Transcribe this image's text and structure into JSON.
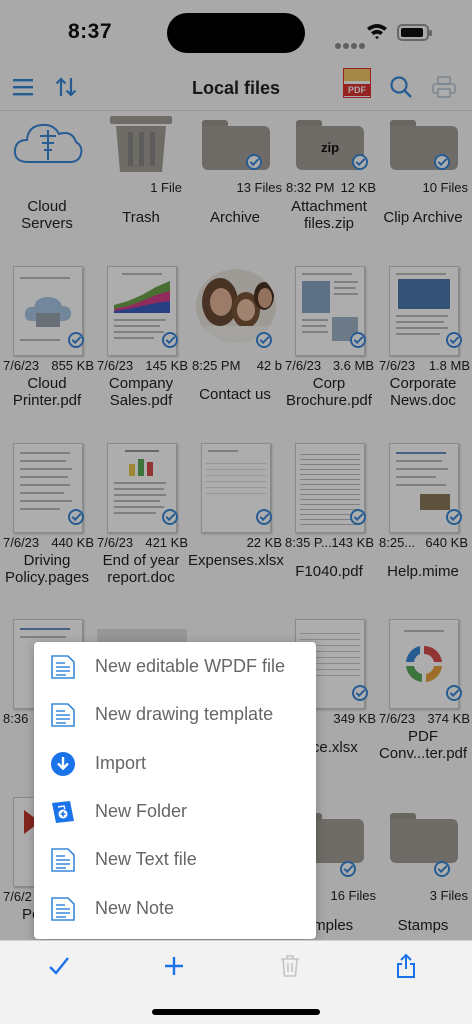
{
  "status": {
    "time": "8:37"
  },
  "nav": {
    "title": "Local files",
    "pdf_logo_text": "PDF"
  },
  "row1": [
    {
      "name": "Cloud Servers",
      "meta_left": "",
      "meta_right": ""
    },
    {
      "name": "Trash",
      "meta_left": "",
      "meta_right": "1 File"
    },
    {
      "name": "Archive",
      "meta_left": "",
      "meta_right": "13 Files"
    },
    {
      "name": "Attachment files.zip",
      "meta_left": "8:32 PM",
      "meta_right": "12 KB",
      "badge": "zip"
    },
    {
      "name": "Clip Archive",
      "meta_left": "",
      "meta_right": "10 Files"
    }
  ],
  "row2": [
    {
      "name": "Cloud Printer.pdf",
      "meta_left": "7/6/23",
      "meta_right": "855 KB"
    },
    {
      "name": "Company Sales.pdf",
      "meta_left": "7/6/23",
      "meta_right": "145 KB"
    },
    {
      "name": "Contact us",
      "meta_left": "8:25 PM",
      "meta_right": "42 b"
    },
    {
      "name": "Corp Brochure.pdf",
      "meta_left": "7/6/23",
      "meta_right": "3.6 MB"
    },
    {
      "name": "Corporate News.doc",
      "meta_left": "7/6/23",
      "meta_right": "1.8 MB"
    }
  ],
  "row3": [
    {
      "name": "Driving Policy.pages",
      "meta_left": "7/6/23",
      "meta_right": "440 KB"
    },
    {
      "name": "End of year report.doc",
      "meta_left": "7/6/23",
      "meta_right": "421 KB"
    },
    {
      "name": "Expenses.xlsx",
      "meta_left": "",
      "meta_right": "22 KB"
    },
    {
      "name": "F1040.pdf",
      "meta_left": "8:35 P...",
      "meta_right": "143 KB"
    },
    {
      "name": "Help.mime",
      "meta_left": "8:25...",
      "meta_right": "640 KB"
    }
  ],
  "row4": [
    {
      "name": "He",
      "meta_left": "8:36",
      "meta_right": ""
    },
    {
      "name": "",
      "meta_left": "",
      "meta_right": ""
    },
    {
      "name": "",
      "meta_left": "",
      "meta_right": ""
    },
    {
      "name": "oice.xlsx",
      "meta_left": "3",
      "meta_right": "349 KB"
    },
    {
      "name": "PDF Conv...ter.pdf",
      "meta_left": "7/6/23",
      "meta_right": "374 KB"
    }
  ],
  "row5": [
    {
      "name": "Po Rea",
      "meta_left": "7/6/2",
      "meta_right": ""
    },
    {
      "name": "",
      "meta_left": "",
      "meta_right": ""
    },
    {
      "name": "",
      "meta_left": "",
      "meta_right": ""
    },
    {
      "name": "amples",
      "meta_left": "",
      "meta_right": "16 Files"
    },
    {
      "name": "Stamps",
      "meta_left": "",
      "meta_right": "3 Files"
    }
  ],
  "menu": [
    {
      "label": "New editable WPDF file",
      "icon": "document-lines-icon"
    },
    {
      "label": "New drawing template",
      "icon": "document-lines-icon"
    },
    {
      "label": "Import",
      "icon": "download-circle-icon"
    },
    {
      "label": "New Folder",
      "icon": "folder-add-icon"
    },
    {
      "label": "New Text file",
      "icon": "document-lines-icon"
    },
    {
      "label": "New Note",
      "icon": "document-lines-icon"
    }
  ],
  "colors": {
    "accent": "#3a88d9",
    "folder": "#a49f98"
  }
}
